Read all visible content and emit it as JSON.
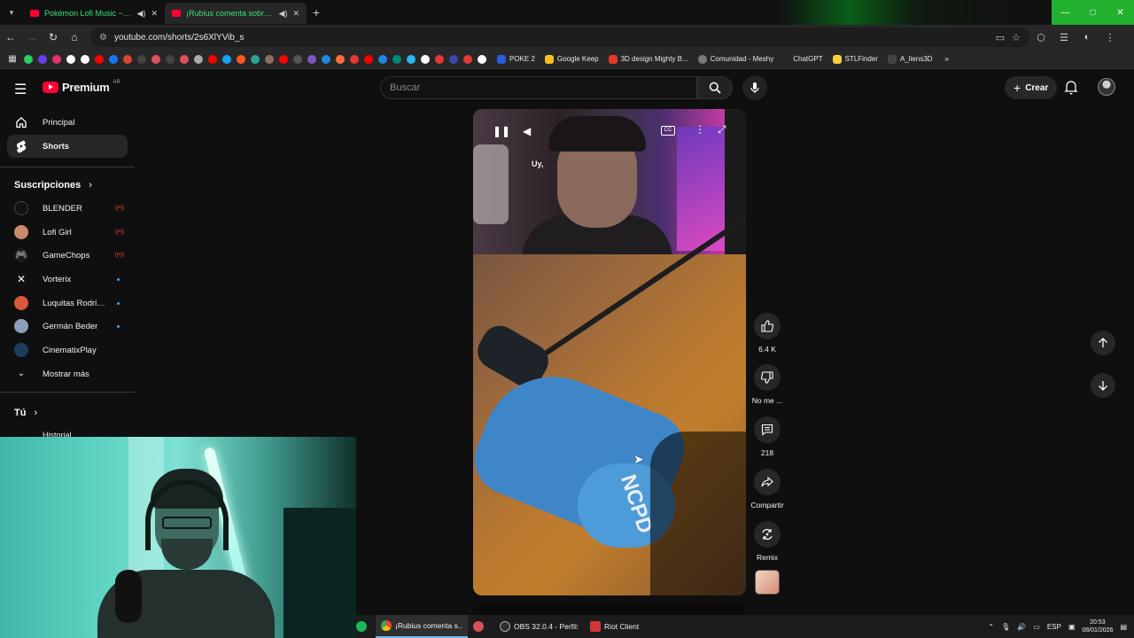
{
  "browser": {
    "tabs": [
      {
        "title": "Pokémon Lofi Music ~ 1 H",
        "active": false
      },
      {
        "title": "¡Rubius comenta sobre Cyb",
        "active": true
      }
    ],
    "new_tab": "+",
    "url": "youtube.com/shorts/2s6XlYVib_s",
    "window_controls": [
      "—",
      "□",
      "✕"
    ],
    "bookmarks": [
      {
        "label": "POKE 2",
        "color": "#2b5bd7"
      },
      {
        "label": "Google Keep",
        "color": "#f6bf26"
      },
      {
        "label": "3D design Mighty B...",
        "color": "#e23a2e"
      },
      {
        "label": "Comunidad - Meshy",
        "color": "#7b7b7b"
      },
      {
        "label": "ChatGPT",
        "color": ""
      },
      {
        "label": "STLFinder",
        "color": "#f3d23e"
      },
      {
        "label": "A_liens3D",
        "color": "#444444"
      }
    ],
    "bookmark_icon_colors": [
      "#25d366",
      "#6a3df0",
      "#e1306c",
      "#ffffff",
      "#ffffff",
      "#ff0000",
      "#1877f2",
      "#db4437",
      "#444",
      "#e04f5f",
      "#444",
      "#e04f5f",
      "#aaa",
      "#ff0000",
      "#1da1f2",
      "#ff5722",
      "#26a69a",
      "#8d6e63",
      "#ff0000",
      "#555",
      "#7e57c2",
      "#1e88e5",
      "#ff7043",
      "#e53935",
      "#ff0000",
      "#1e88e5",
      "#00897b",
      "#29b6f6",
      "#fff",
      "#e53935",
      "#3949ab",
      "#e53935",
      "#fff"
    ]
  },
  "youtube": {
    "logo_text": "Premium",
    "country": "AR",
    "search_placeholder": "Buscar",
    "create_label": "Crear",
    "sidebar": {
      "items": [
        {
          "label": "Principal",
          "icon": "home-icon",
          "active": false
        },
        {
          "label": "Shorts",
          "icon": "shorts-icon",
          "active": true
        }
      ],
      "subscriptions_title": "Suscripciones",
      "subscriptions": [
        {
          "name": "BLENDER",
          "status": "live",
          "avatar": "#111111"
        },
        {
          "name": "Lofi Girl",
          "status": "live",
          "avatar": "#c98b6a"
        },
        {
          "name": "GameChops",
          "status": "live",
          "avatar": "#1a1a1a"
        },
        {
          "name": "Vorterix",
          "status": "new",
          "avatar": "#111111"
        },
        {
          "name": "Luquitas Rodrigu...",
          "status": "new",
          "avatar": "#d9583b"
        },
        {
          "name": "Germán Beder",
          "status": "new",
          "avatar": "#8aa0b8"
        },
        {
          "name": "CinematixPlay",
          "status": "",
          "avatar": "#1f3c5c"
        }
      ],
      "show_more": "Mostrar más",
      "you_title": "Tú",
      "history": "Historial"
    },
    "short": {
      "caption": "Uy,",
      "cc": "CC",
      "likes": "6.4 K",
      "dislike_label": "No me ...",
      "comments": "218",
      "share_label": "Compartir",
      "remix_label": "Remix",
      "helmet_text": "NCPD"
    }
  },
  "taskbar": {
    "items": [
      {
        "label": "¡Rubius comenta s...",
        "active": true,
        "color": "#e8e8e8"
      },
      {
        "label": "",
        "active": false,
        "color": "#d94f58"
      },
      {
        "label": "OBS 32.0.4 - Perfil: ...",
        "active": false,
        "color": "#303030"
      },
      {
        "label": "Riot Client",
        "active": false,
        "color": "#d13639"
      }
    ],
    "lang": "ESP",
    "time": "20:53",
    "date": "08/01/2026"
  }
}
